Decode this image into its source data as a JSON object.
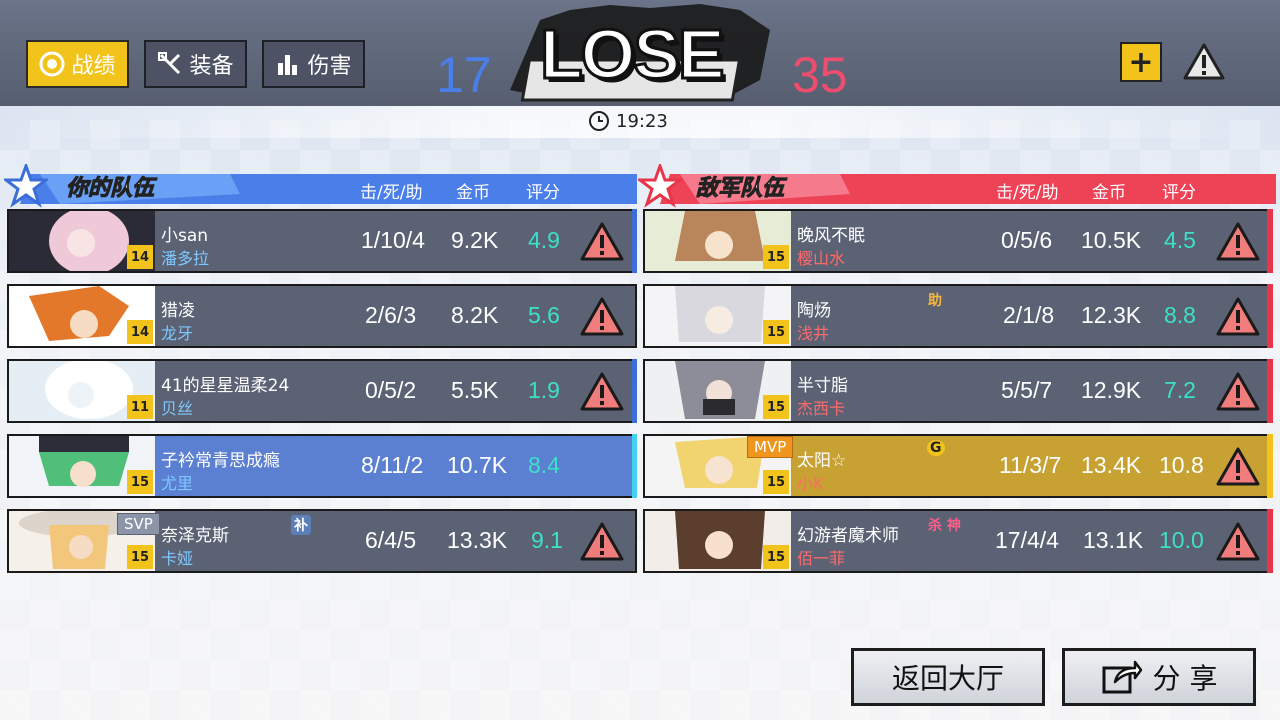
{
  "tabs": [
    {
      "label": "战绩",
      "icon": "target-icon",
      "active": true
    },
    {
      "label": "装备",
      "icon": "tools-icon",
      "active": false
    },
    {
      "label": "伤害",
      "icon": "bar-chart-icon",
      "active": false
    }
  ],
  "result": {
    "text": "LOSE",
    "score_blue": "17",
    "score_red": "35"
  },
  "timer": "19:23",
  "team_blue": {
    "title": "你的队伍",
    "headers": {
      "kda": "击/死/助",
      "gold": "金币",
      "rating": "评分"
    }
  },
  "team_red": {
    "title": "敌军队伍",
    "headers": {
      "kda": "击/死/助",
      "gold": "金币",
      "rating": "评分"
    }
  },
  "players_blue": [
    {
      "name": "小san",
      "hero": "潘多拉",
      "level": "14",
      "kda": "1/10/4",
      "gold": "9.2K",
      "rating": "4.9",
      "badge": "",
      "tag": ""
    },
    {
      "name": "猎凌",
      "hero": "龙牙",
      "level": "14",
      "kda": "2/6/3",
      "gold": "8.2K",
      "rating": "5.6",
      "badge": "",
      "tag": ""
    },
    {
      "name": "41的星星温柔24",
      "hero": "贝丝",
      "level": "11",
      "kda": "0/5/2",
      "gold": "5.5K",
      "rating": "1.9",
      "badge": "",
      "tag": ""
    },
    {
      "name": "子衿常青思成瘾",
      "hero": "尤里",
      "level": "15",
      "kda": "8/11/2",
      "gold": "10.7K",
      "rating": "8.4",
      "badge": "",
      "tag": ""
    },
    {
      "name": "奈泽克斯",
      "hero": "卡娅",
      "level": "15",
      "kda": "6/4/5",
      "gold": "13.3K",
      "rating": "9.1",
      "badge": "SVP",
      "tag": "补"
    }
  ],
  "players_red": [
    {
      "name": "晚风不眠",
      "hero": "樱山水",
      "level": "15",
      "kda": "0/5/6",
      "gold": "10.5K",
      "rating": "4.5",
      "badge": "",
      "tag": ""
    },
    {
      "name": "陶炀",
      "hero": "浅井",
      "level": "15",
      "kda": "2/1/8",
      "gold": "12.3K",
      "rating": "8.8",
      "badge": "",
      "tag": "助"
    },
    {
      "name": "半寸脂",
      "hero": "杰西卡",
      "level": "15",
      "kda": "5/5/7",
      "gold": "12.9K",
      "rating": "7.2",
      "badge": "",
      "tag": ""
    },
    {
      "name": "太阳☆",
      "hero": "小K",
      "level": "15",
      "kda": "11/3/7",
      "gold": "13.4K",
      "rating": "10.8",
      "badge": "MVP",
      "tag": "G"
    },
    {
      "name": "幻游者魔术师",
      "hero": "佰一菲",
      "level": "15",
      "kda": "17/4/4",
      "gold": "13.1K",
      "rating": "10.0",
      "badge": "",
      "tag": "杀 神"
    }
  ],
  "buttons": {
    "lobby": "返回大厅",
    "share": "分 享"
  },
  "colors": {
    "accent_yellow": "#f2c31b",
    "blue_team": "#4a7ee8",
    "red_team": "#ee4d6e",
    "rating": "#3de0c8"
  }
}
